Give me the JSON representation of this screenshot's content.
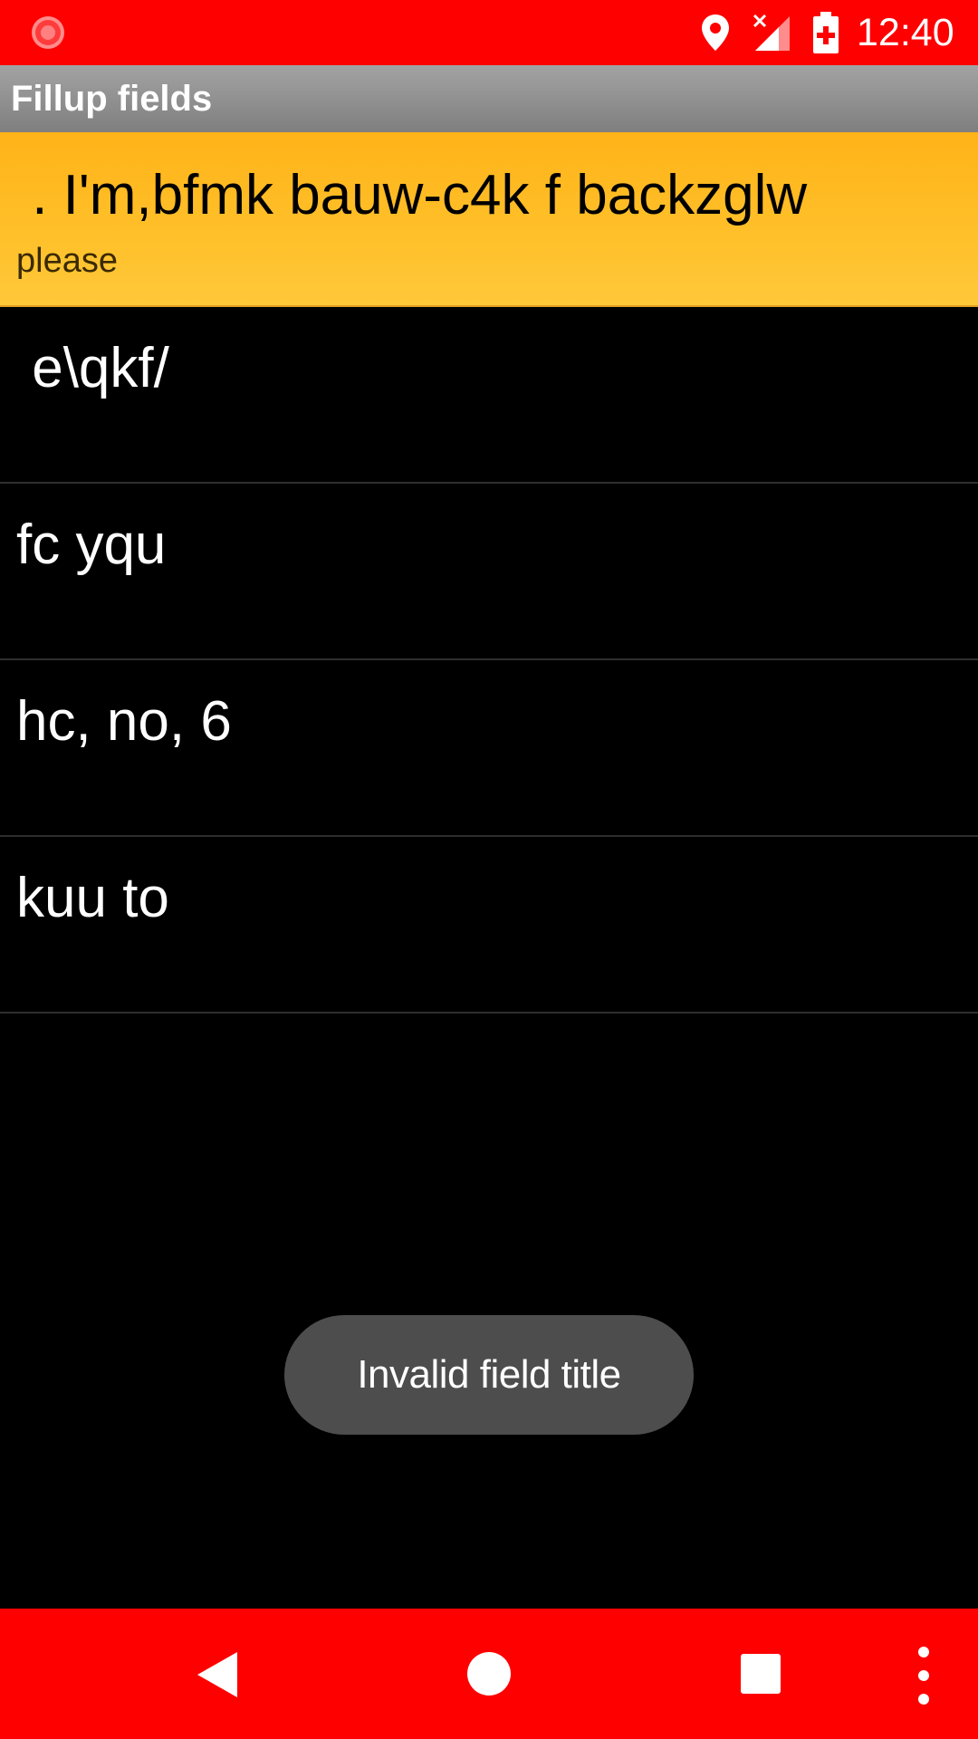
{
  "status_bar": {
    "time": "12:40",
    "icons": [
      "record-icon",
      "location-icon",
      "signal-no-data-icon",
      "battery-charging-icon"
    ]
  },
  "app_bar": {
    "title": "Fillup fields"
  },
  "list": {
    "items": [
      {
        "title": " . I'm,bfmk bauw-c4k f backzglw",
        "subtitle": "please",
        "highlighted": true
      },
      {
        "title": " e\\qkf/"
      },
      {
        "title": "fc yqu"
      },
      {
        "title": "hc, no, 6"
      },
      {
        "title": "kuu to"
      }
    ]
  },
  "toast": {
    "message": "Invalid field title"
  },
  "nav_bar": {
    "icons": [
      "back-icon",
      "home-icon",
      "recent-apps-icon",
      "more-options-icon"
    ]
  },
  "colors": {
    "status_bar": "#ff0000",
    "nav_bar": "#ff0000",
    "app_bar": "#8f8f8f",
    "highlight": "#ffb818",
    "background": "#000000",
    "toast": "#4d4d4d"
  }
}
